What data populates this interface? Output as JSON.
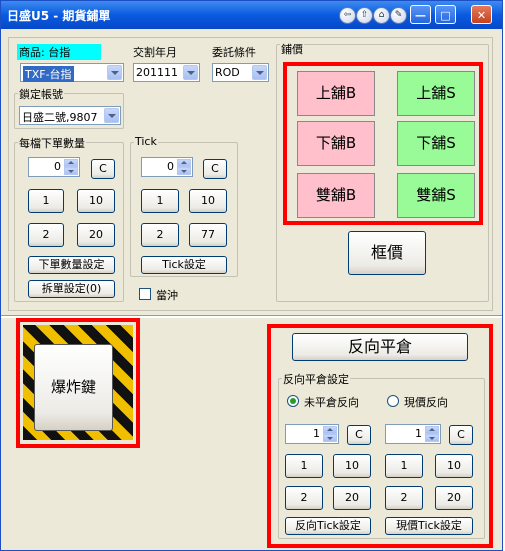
{
  "window": {
    "title": "日盛U5 - 期貨鋪單"
  },
  "titlebar": {
    "icons": [
      "back-icon",
      "upload-icon",
      "home-icon",
      "pin-icon"
    ],
    "min_label": "—",
    "max_label": "□",
    "close_label": "✕"
  },
  "product": {
    "label": "商品: 台指",
    "value": "TXF-台指"
  },
  "delivery": {
    "label": "交割年月",
    "value": "201111"
  },
  "condition": {
    "label": "委託條件",
    "value": "ROD"
  },
  "account": {
    "label": "鎖定帳號",
    "value": "日盛二號,9807"
  },
  "qty": {
    "label": "每檔下單數量",
    "value": "0",
    "clear": "C",
    "preset1": "1",
    "preset2": "10",
    "preset3": "2",
    "preset4": "20",
    "set_btn": "下單數量設定",
    "split_btn": "拆單設定(0)"
  },
  "tick": {
    "label": "Tick",
    "value": "0",
    "clear": "C",
    "preset1": "1",
    "preset2": "10",
    "preset3": "2",
    "preset4": "77",
    "set_btn": "Tick設定"
  },
  "hedge": {
    "label": "當沖"
  },
  "order": {
    "label": "鋪價",
    "buy_up": "上舖B",
    "sell_up": "上舖S",
    "buy_down": "下舖B",
    "sell_down": "下舖S",
    "buy_both": "雙舖B",
    "sell_both": "雙舖S",
    "frame_price": "框價"
  },
  "bomb": {
    "label": "爆炸鍵"
  },
  "reverse": {
    "button": "反向平倉",
    "settings_label": "反向平倉設定",
    "radio1": "未平倉反向",
    "radio2": "現價反向",
    "left": {
      "value": "1",
      "clear": "C",
      "p1": "1",
      "p2": "10",
      "p3": "2",
      "p4": "20",
      "set_btn": "反向Tick設定"
    },
    "right": {
      "value": "1",
      "clear": "C",
      "p1": "1",
      "p2": "10",
      "p3": "2",
      "p4": "20",
      "set_btn": "現價Tick設定"
    }
  },
  "colors": {
    "titlebar": "#0a5ae0",
    "highlight_box": "#ff0000",
    "buy": "#ffc0cb",
    "sell": "#98fb98",
    "product_label_bg": "#00ffff"
  }
}
